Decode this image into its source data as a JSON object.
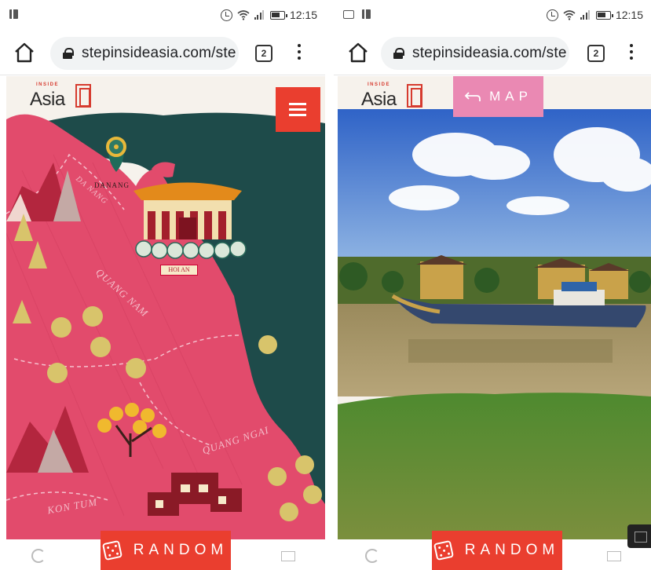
{
  "left_phone": {
    "status_bar": {
      "time": "12:15"
    },
    "browser": {
      "url": "stepinsideasia.com/ste",
      "tab_count": "2"
    },
    "site": {
      "logo_small": "INSIDE",
      "logo_main": "Asia",
      "map_labels": {
        "danang": "DANANG",
        "da_nang_province": "DA NANG",
        "quang_nam": "QUANG NAM",
        "quang_ngai": "QUANG NGAI",
        "kon_tum": "KON TUM",
        "hoi_an": "HOI AN"
      },
      "random_button": "RANDOM"
    },
    "icons": [
      "home-icon",
      "lock-icon",
      "menu-icon",
      "hamburger-icon",
      "map-pin-icon",
      "dice-icon"
    ]
  },
  "right_phone": {
    "status_bar": {
      "time": "12:15"
    },
    "browser": {
      "url": "stepinsideasia.com/ste",
      "tab_count": "2"
    },
    "site": {
      "logo_small": "INSIDE",
      "logo_main": "Asia",
      "map_button": "MAP",
      "random_button": "RANDOM"
    },
    "icons": [
      "home-icon",
      "lock-icon",
      "back-arrow-icon",
      "dice-icon"
    ]
  },
  "colors": {
    "accent_red": "#ea3e2f",
    "map_pink": "#e24b6c",
    "sea_green": "#1f4e4c",
    "map_button_pink": "#ea89b3"
  }
}
